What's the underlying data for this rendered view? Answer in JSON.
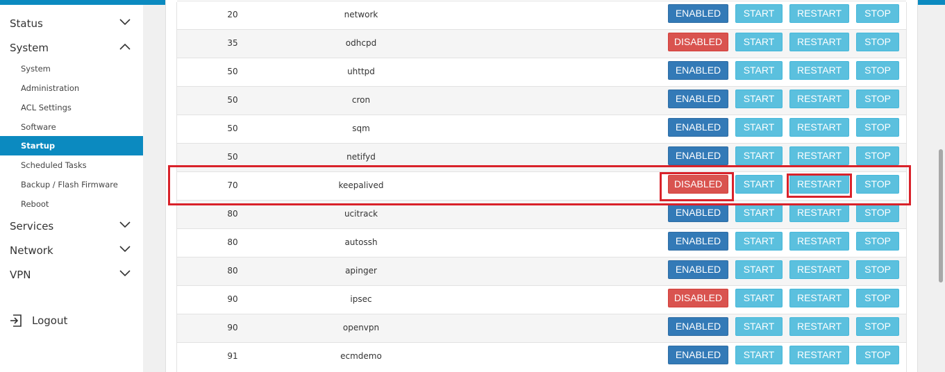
{
  "sidebar": {
    "groups": {
      "status": {
        "label": "Status",
        "expanded": false
      },
      "system": {
        "label": "System",
        "expanded": true
      },
      "services": {
        "label": "Services",
        "expanded": false
      },
      "network": {
        "label": "Network",
        "expanded": false
      },
      "vpn": {
        "label": "VPN",
        "expanded": false
      }
    },
    "system_items": [
      {
        "label": "System",
        "active": false
      },
      {
        "label": "Administration",
        "active": false
      },
      {
        "label": "ACL Settings",
        "active": false
      },
      {
        "label": "Software",
        "active": false
      },
      {
        "label": "Startup",
        "active": true
      },
      {
        "label": "Scheduled Tasks",
        "active": false
      },
      {
        "label": "Backup / Flash Firmware",
        "active": false
      },
      {
        "label": "Reboot",
        "active": false
      }
    ],
    "logout_label": "Logout"
  },
  "startup_table": {
    "rows": [
      {
        "priority": "20",
        "name": "network",
        "state": "ENABLED"
      },
      {
        "priority": "35",
        "name": "odhcpd",
        "state": "DISABLED"
      },
      {
        "priority": "50",
        "name": "uhttpd",
        "state": "ENABLED"
      },
      {
        "priority": "50",
        "name": "cron",
        "state": "ENABLED"
      },
      {
        "priority": "50",
        "name": "sqm",
        "state": "ENABLED"
      },
      {
        "priority": "50",
        "name": "netifyd",
        "state": "ENABLED"
      },
      {
        "priority": "70",
        "name": "keepalived",
        "state": "DISABLED"
      },
      {
        "priority": "80",
        "name": "ucitrack",
        "state": "ENABLED"
      },
      {
        "priority": "80",
        "name": "autossh",
        "state": "ENABLED"
      },
      {
        "priority": "80",
        "name": "apinger",
        "state": "ENABLED"
      },
      {
        "priority": "90",
        "name": "ipsec",
        "state": "DISABLED"
      },
      {
        "priority": "90",
        "name": "openvpn",
        "state": "ENABLED"
      },
      {
        "priority": "91",
        "name": "ecmdemo",
        "state": "ENABLED"
      }
    ],
    "actions": {
      "start": "START",
      "restart": "RESTART",
      "stop": "STOP"
    }
  },
  "colors": {
    "accent": "#0b8ac0",
    "enabled": "#337ab7",
    "disabled": "#d9534f",
    "action": "#5bc0de",
    "highlight": "#d9222a"
  }
}
